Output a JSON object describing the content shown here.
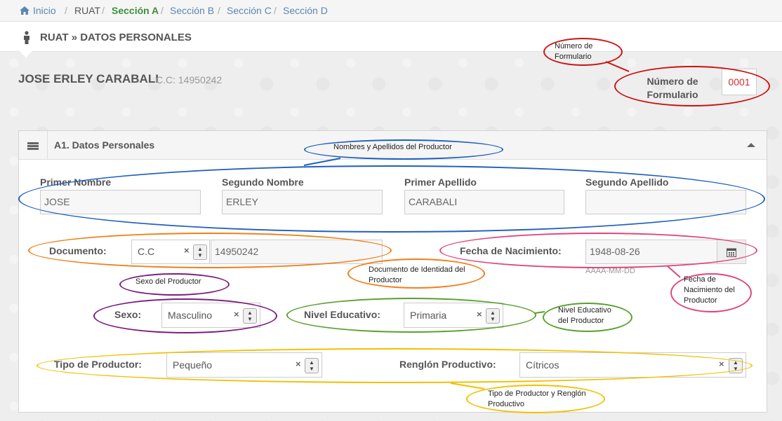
{
  "breadcrumb": {
    "home": "Inicio",
    "items": [
      "RUAT",
      "Sección A",
      "Sección B",
      "Sección C",
      "Sección D"
    ]
  },
  "header": {
    "title": "RUAT » DATOS PERSONALES"
  },
  "person": {
    "name": "JOSE ERLEY CARABALI",
    "id": "C.C: 14950242"
  },
  "form_number": {
    "label": "Número de Formulario",
    "value": "0001"
  },
  "panel": {
    "title": "A1. Datos Personales"
  },
  "fields": {
    "primer_nombre": {
      "label": "Primer Nombre",
      "value": "JOSE"
    },
    "segundo_nombre": {
      "label": "Segundo Nombre",
      "value": "ERLEY"
    },
    "primer_apellido": {
      "label": "Primer Apellido",
      "value": "CARABALI"
    },
    "segundo_apellido": {
      "label": "Segundo Apellido",
      "value": ""
    },
    "documento": {
      "label": "Documento:",
      "type": "C.C",
      "number": "14950242"
    },
    "fecha_nacimiento": {
      "label": "Fecha de Nacimiento:",
      "value": "1948-08-26",
      "hint": "AAAA-MM-DD"
    },
    "sexo": {
      "label": "Sexo:",
      "value": "Masculino"
    },
    "nivel_educativo": {
      "label": "Nivel Educativo:",
      "value": "Primaria"
    },
    "tipo_productor": {
      "label": "Tipo de Productor:",
      "value": "Pequeño"
    },
    "renglon_productivo": {
      "label": "Renglón Productivo:",
      "value": "Cítricos"
    }
  },
  "annotations": {
    "numero_formulario": "Número de Formulario",
    "nombres": "Nombres y Apellidos del Productor",
    "documento": "Documento de Identidad del Productor",
    "fecha": "Fecha de Nacimiento del Productor",
    "sexo": "Sexo del Productor",
    "nivel": "Nivel Educativo del Productor",
    "tipo": "Tipo de Productor y Renglón Productivo"
  },
  "icons": {
    "home": "home-icon",
    "person": "person-icon",
    "menu": "hamburger-icon",
    "collapse": "caret-up-icon",
    "calendar": "calendar-icon",
    "clear": "clear-icon",
    "spinner": "spinner-icon"
  },
  "colors": {
    "link": "#5c87b2",
    "active_crumb": "#3d8f3d",
    "form_number": "#d03030",
    "red_annotation": "#cc1111",
    "blue_annotation": "#1f5fbf",
    "orange_annotation": "#ef7f1a",
    "pink_annotation": "#e0457b",
    "purple_annotation": "#7a1f7a",
    "green_annotation": "#5aa02c",
    "yellow_annotation": "#f0c000"
  }
}
